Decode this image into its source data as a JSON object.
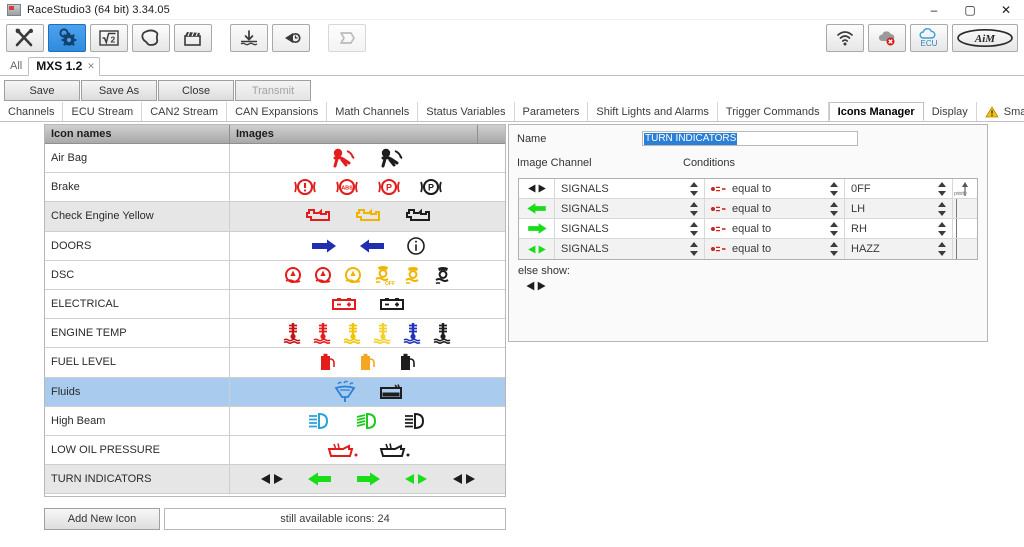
{
  "window": {
    "title": "RaceStudio3 (64 bit) 3.34.05",
    "app_icon": "racestudio-icon",
    "minimize": "–",
    "maximize": "▢",
    "close": "✕"
  },
  "toolbar": {
    "left_buttons": [
      {
        "name": "tools-button",
        "icon": "wrench-screwdriver-icon",
        "selected": false
      },
      {
        "name": "configurations-button",
        "icon": "gear-cog-icon",
        "selected": true
      },
      {
        "name": "math-channels-button",
        "icon": "square-root-2-icon",
        "selected": false
      },
      {
        "name": "tracks-button",
        "icon": "track-shape-icon",
        "selected": false
      },
      {
        "name": "movie-button",
        "icon": "clapperboard-icon",
        "selected": false
      },
      {
        "name": "download-button",
        "icon": "download-water-icon",
        "selected": false
      },
      {
        "name": "history-button",
        "icon": "undo-clock-icon",
        "selected": false
      },
      {
        "name": "sync-button",
        "icon": "transfer-arrow-icon",
        "selected": false,
        "disabled": true
      }
    ],
    "right_buttons": [
      {
        "name": "wifi-button",
        "icon": "wifi-icon"
      },
      {
        "name": "cloud-offline-button",
        "icon": "cloud-error-icon"
      },
      {
        "name": "ecu-cloud-button",
        "icon": "cloud-ecu-icon",
        "label": "ECU"
      },
      {
        "name": "aim-logo-button",
        "icon": "aim-logo-icon"
      }
    ]
  },
  "device_tabs": {
    "all_label": "All",
    "active_label": "MXS 1.2",
    "close_glyph": "✕"
  },
  "action_bar": {
    "buttons": [
      {
        "label": "Save",
        "disabled": false
      },
      {
        "label": "Save As",
        "disabled": false
      },
      {
        "label": "Close",
        "disabled": false
      },
      {
        "label": "Transmit",
        "disabled": true
      }
    ]
  },
  "main_tabs": {
    "items": [
      {
        "label": "Channels",
        "active": false
      },
      {
        "label": "ECU Stream",
        "active": false
      },
      {
        "label": "CAN2 Stream",
        "active": false
      },
      {
        "label": "CAN Expansions",
        "active": false
      },
      {
        "label": "Math Channels",
        "active": false
      },
      {
        "label": "Status Variables",
        "active": false
      },
      {
        "label": "Parameters",
        "active": false
      },
      {
        "label": "Shift Lights and Alarms",
        "active": false
      },
      {
        "label": "Trigger Commands",
        "active": false
      },
      {
        "label": "Icons Manager",
        "active": true
      },
      {
        "label": "Display",
        "active": false
      },
      {
        "label": "SmartyCam",
        "active": false,
        "warn_icon": "warning-triangle-icon"
      }
    ],
    "scroll_left": "◄",
    "scroll_right": "►"
  },
  "icon_grid": {
    "headers": {
      "names": "Icon names",
      "images": "Images",
      "extra": ""
    },
    "rows": [
      {
        "name": "Air Bag",
        "selected": false,
        "icons": [
          "airbag-red-icon",
          "airbag-black-icon"
        ]
      },
      {
        "name": "Brake",
        "selected": false,
        "icons": [
          "brake-exclaim-red-icon",
          "brake-abs-red-icon",
          "brake-park-red-icon",
          "brake-park-black-icon"
        ]
      },
      {
        "name": "Check Engine Yellow",
        "selected": false,
        "icons": [
          "check-engine-red-icon",
          "check-engine-yellow-icon",
          "check-engine-black-icon"
        ]
      },
      {
        "name": "DOORS",
        "selected": false,
        "icons": [
          "door-right-blue-icon",
          "door-left-blue-icon",
          "info-circle-black-icon"
        ]
      },
      {
        "name": "DSC",
        "selected": false,
        "icons": [
          "dsc-red-icon",
          "dsc-red2-icon",
          "dsc-yellow-icon",
          "traction-off-yellow-icon",
          "traction-yellow-icon",
          "traction-black-icon"
        ]
      },
      {
        "name": "ELECTRICAL",
        "selected": false,
        "icons": [
          "battery-red-icon",
          "battery-black-icon"
        ]
      },
      {
        "name": "ENGINE TEMP",
        "selected": false,
        "icons": [
          "coolant-red-icon",
          "coolant-red2-icon",
          "coolant-yellow-icon",
          "coolant-yellow2-icon",
          "coolant-blue-icon",
          "coolant-black-icon"
        ]
      },
      {
        "name": "FUEL LEVEL",
        "selected": false,
        "icons": [
          "fuel-red-icon",
          "fuel-yellow-icon",
          "fuel-black-icon"
        ]
      },
      {
        "name": "Fluids",
        "selected": true,
        "icons": [
          "washer-fluid-blue-icon",
          "brake-fluid-black-icon"
        ]
      },
      {
        "name": "High Beam",
        "selected": false,
        "icons": [
          "high-beam-blue-icon",
          "high-beam-green-icon",
          "high-beam-black-icon"
        ]
      },
      {
        "name": "LOW OIL PRESSURE",
        "selected": false,
        "icons": [
          "oil-can-red-icon",
          "oil-can-black-icon"
        ]
      },
      {
        "name": "TURN INDICATORS",
        "selected": false,
        "icons": [
          "turn-both-black-icon",
          "turn-left-green-icon",
          "turn-right-green-icon",
          "turn-both-green-icon",
          "turn-both-black2-icon"
        ]
      }
    ],
    "add_button": "Add New Icon",
    "available_text": "still available icons: 24"
  },
  "detail_panel": {
    "name_label": "Name",
    "name_value": "TURN INDICATORS",
    "image_label": "Image",
    "channel_label": "Channel",
    "conditions_label": "Conditions",
    "priority_label": "priority",
    "else_show_label": "else show:",
    "else_icon": "turn-both-black-icon",
    "conditions": [
      {
        "icon": "turn-both-black-icon",
        "channel": "SIGNALS",
        "operator": "equal to",
        "operator_icon": "equal-to-icon",
        "value": "0FF"
      },
      {
        "icon": "turn-left-green-icon",
        "channel": "SIGNALS",
        "operator": "equal to",
        "operator_icon": "equal-to-icon",
        "value": "LH"
      },
      {
        "icon": "turn-right-green-icon",
        "channel": "SIGNALS",
        "operator": "equal to",
        "operator_icon": "equal-to-icon",
        "value": "RH"
      },
      {
        "icon": "turn-both-green-icon",
        "channel": "SIGNALS",
        "operator": "equal to",
        "operator_icon": "equal-to-icon",
        "value": "HAZZ"
      }
    ]
  },
  "colors": {
    "selection_blue": "#a9cbee",
    "text_highlight": "#2b7fd6",
    "accent_red": "#e02020",
    "accent_green": "#18d118",
    "accent_yellow": "#f5b800",
    "accent_blue": "#1a3fc8",
    "toolbar_sel": "#2f8bdd"
  }
}
